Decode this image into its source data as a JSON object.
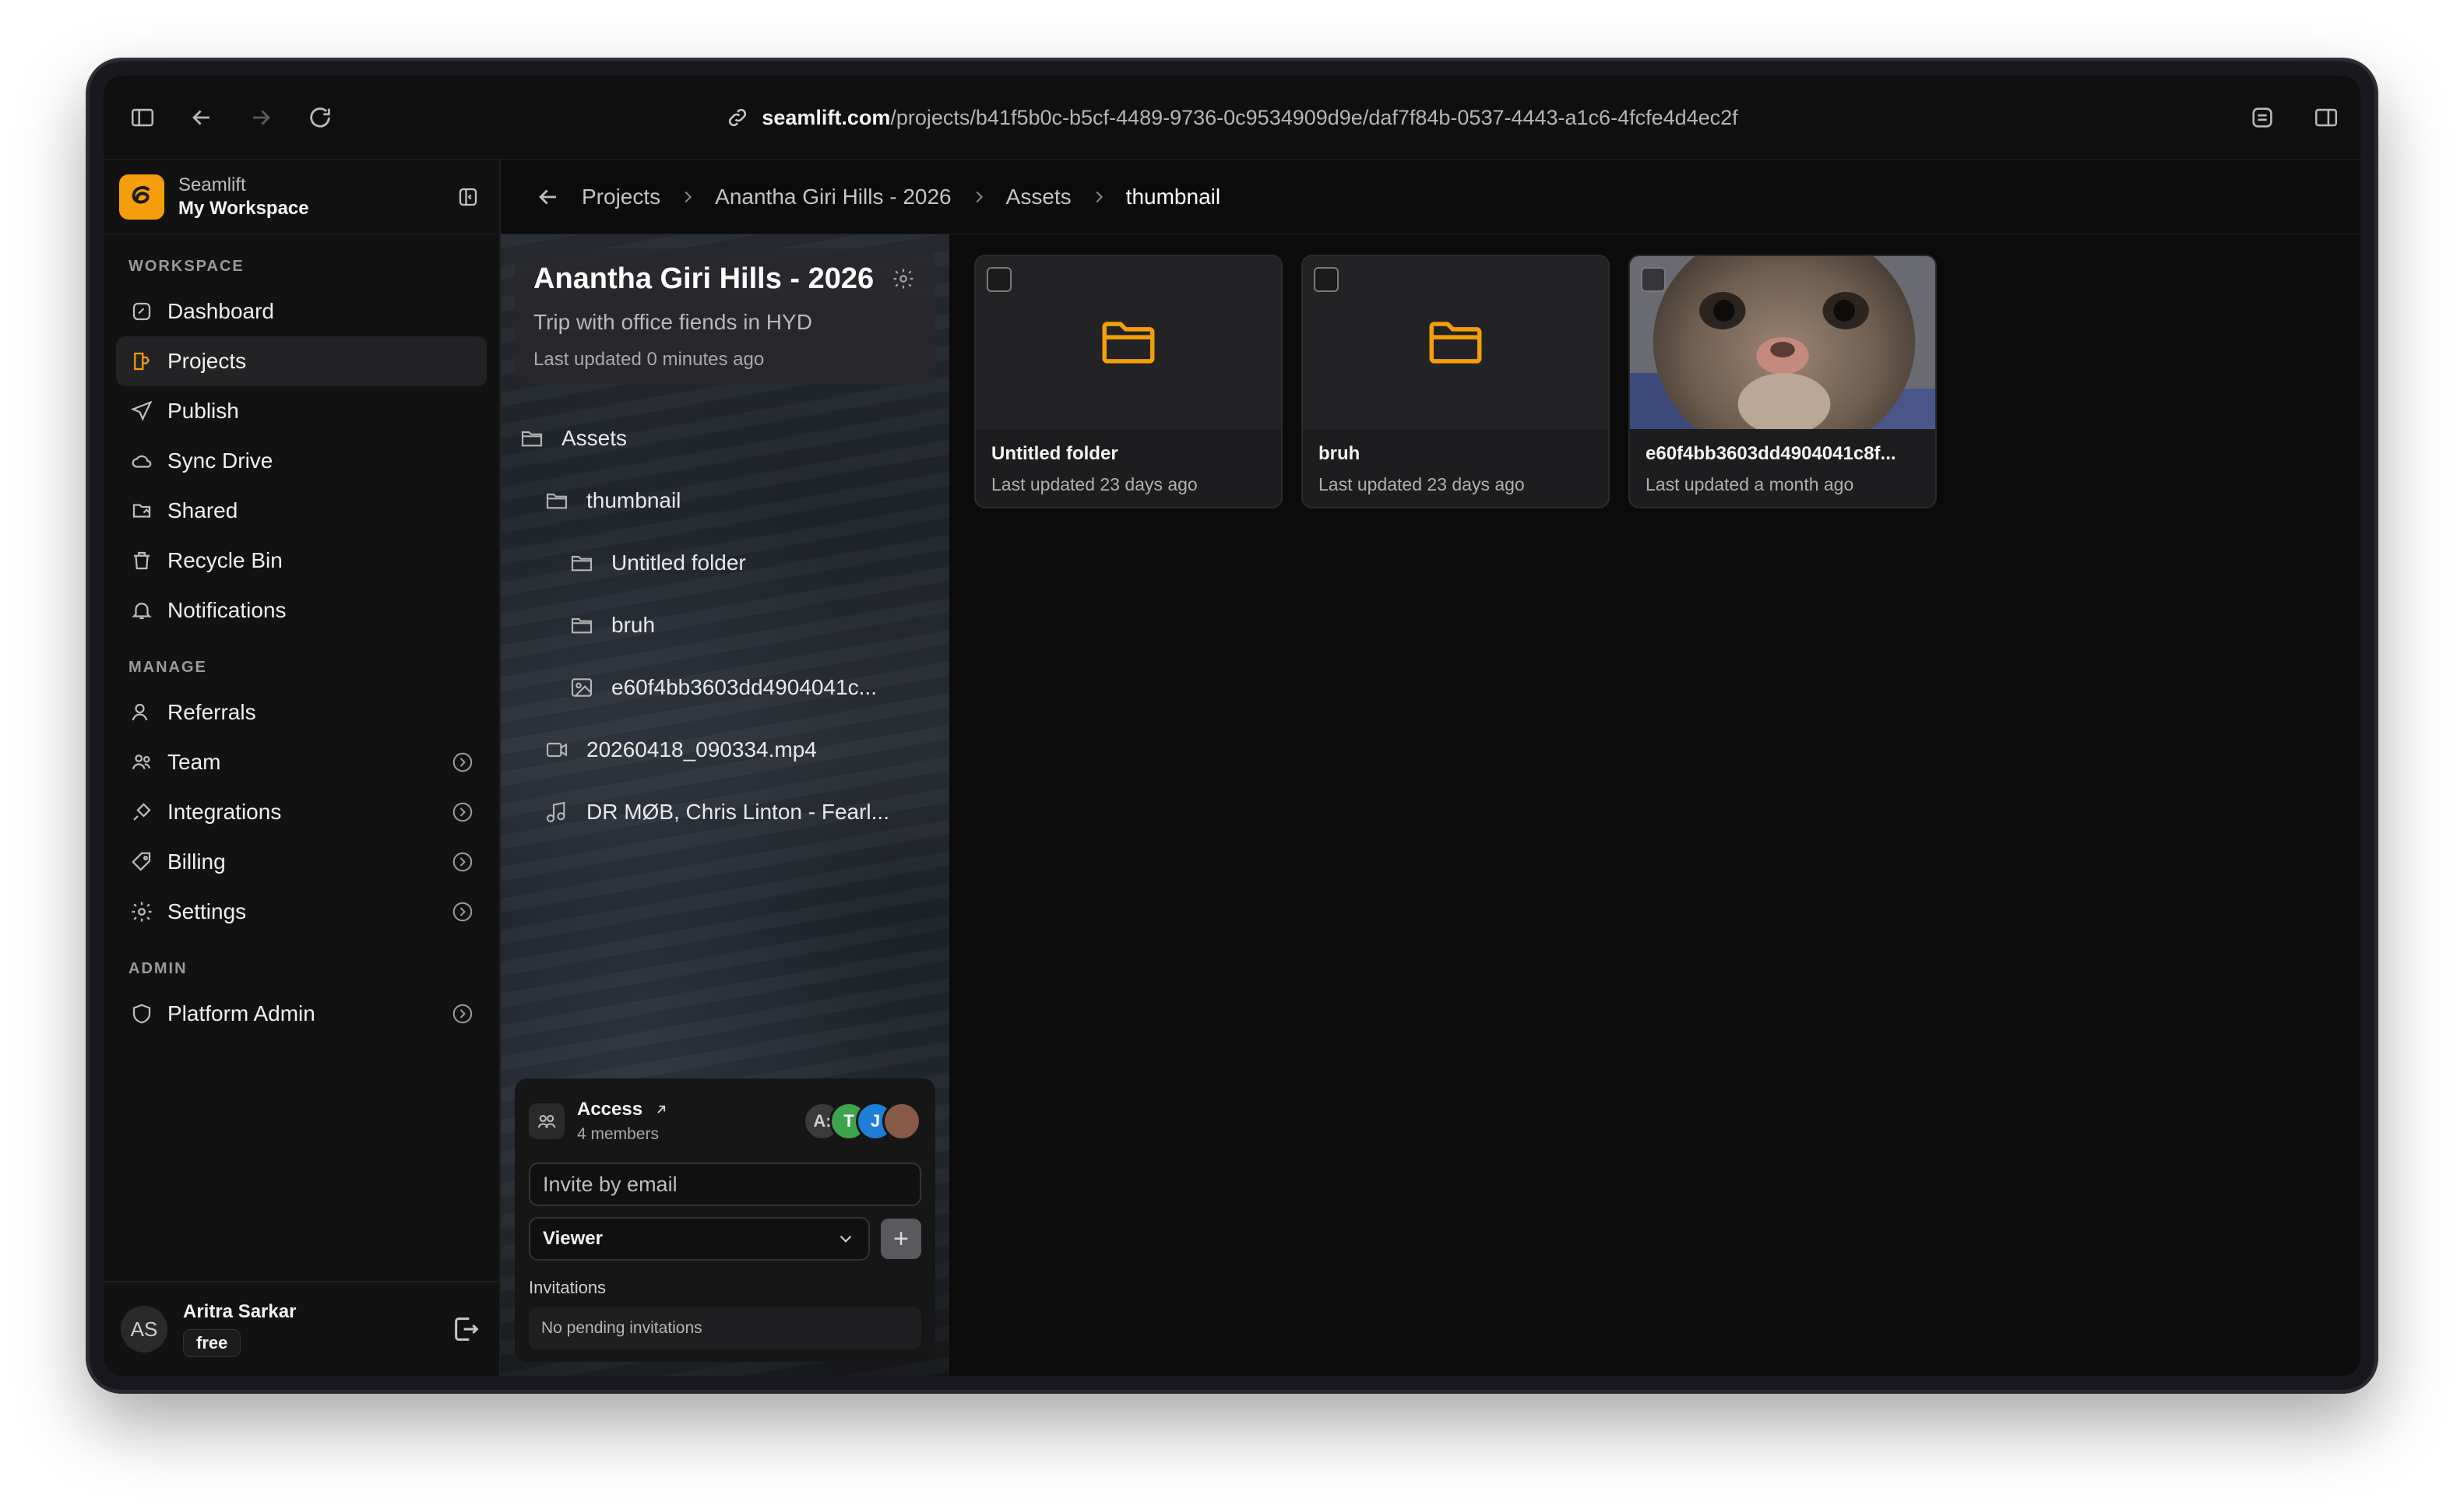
{
  "browser": {
    "url_host": "seamlift.com",
    "url_path": "/projects/b41f5b0c-b5cf-4489-9736-0c9534909d9e/daf7f84b-0537-4443-a1c6-4fcfe4d4ec2f"
  },
  "workspace": {
    "app_name": "Seamlift",
    "name": "My Workspace",
    "accent": "#f59e0b"
  },
  "sidebar": {
    "sections": [
      {
        "label": "WORKSPACE",
        "items": [
          {
            "label": "Dashboard",
            "icon": "dashboard-icon"
          },
          {
            "label": "Projects",
            "icon": "projects-icon",
            "active": true
          },
          {
            "label": "Publish",
            "icon": "send-icon"
          },
          {
            "label": "Sync Drive",
            "icon": "cloud-icon"
          },
          {
            "label": "Shared",
            "icon": "share-icon"
          },
          {
            "label": "Recycle Bin",
            "icon": "trash-icon"
          },
          {
            "label": "Notifications",
            "icon": "bell-icon"
          }
        ]
      },
      {
        "label": "MANAGE",
        "items": [
          {
            "label": "Referrals",
            "icon": "user-plus-icon"
          },
          {
            "label": "Team",
            "icon": "users-icon",
            "chevron": true
          },
          {
            "label": "Integrations",
            "icon": "plug-icon",
            "chevron": true
          },
          {
            "label": "Billing",
            "icon": "tag-icon",
            "chevron": true
          },
          {
            "label": "Settings",
            "icon": "gear-icon",
            "chevron": true
          }
        ]
      },
      {
        "label": "ADMIN",
        "items": [
          {
            "label": "Platform Admin",
            "icon": "shield-icon",
            "chevron": true
          }
        ]
      }
    ]
  },
  "user": {
    "initials": "AS",
    "name": "Aritra Sarkar",
    "plan": "free"
  },
  "breadcrumb": [
    "Projects",
    "Anantha Giri Hills - 2026",
    "Assets",
    "thumbnail"
  ],
  "project": {
    "title": "Anantha Giri Hills - 2026",
    "description": "Trip with office fiends in HYD",
    "updated": "Last updated 0 minutes ago"
  },
  "tree": [
    {
      "label": "Assets",
      "icon": "folder-icon",
      "level": 0
    },
    {
      "label": "thumbnail",
      "icon": "folder-icon",
      "level": 1
    },
    {
      "label": "Untitled folder",
      "icon": "folder-icon",
      "level": 2
    },
    {
      "label": "bruh",
      "icon": "folder-icon",
      "level": 2
    },
    {
      "label": "e60f4bb3603dd4904041c...",
      "icon": "image-icon",
      "level": 2
    },
    {
      "label": "20260418_090334.mp4",
      "icon": "video-icon",
      "level": 1
    },
    {
      "label": "DR MØB, Chris Linton - Fearl...",
      "icon": "music-icon",
      "level": 1
    }
  ],
  "access": {
    "title": "Access",
    "members": "4 members",
    "avatars": [
      {
        "initial": "A:",
        "color": "#3a3a3d"
      },
      {
        "initial": "T",
        "color": "#3fa34d"
      },
      {
        "initial": "J",
        "color": "#1f7ed8"
      },
      {
        "initial": "",
        "color": "#8a5a48"
      }
    ],
    "invite_placeholder": "Invite by email",
    "role": "Viewer",
    "invitations_label": "Invitations",
    "invitations_empty": "No pending invitations"
  },
  "items": [
    {
      "name": "Untitled folder",
      "meta": "Last updated 23 days ago",
      "type": "folder"
    },
    {
      "name": "bruh",
      "meta": "Last updated 23 days ago",
      "type": "folder"
    },
    {
      "name": "e60f4bb3603dd4904041c8f...",
      "meta": "Last updated a month ago",
      "type": "image"
    }
  ]
}
